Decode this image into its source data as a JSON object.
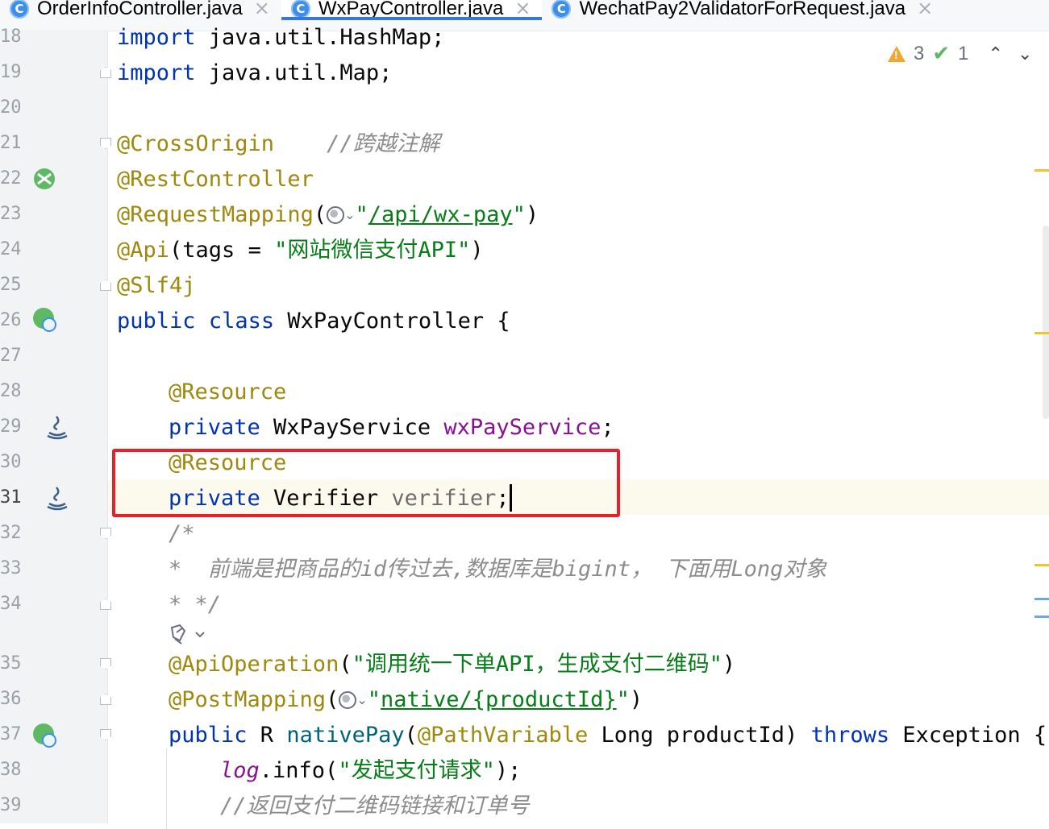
{
  "tabs": [
    {
      "icon": "C",
      "label": "OrderInfoController.java",
      "close": "×",
      "active": false
    },
    {
      "icon": "C",
      "label": "WxPayController.java",
      "close": "×",
      "active": true
    },
    {
      "icon": "C",
      "label": "WechatPay2ValidatorForRequest.java",
      "close": "×",
      "active": false
    }
  ],
  "inspections": {
    "warnings": "3",
    "ok": "1",
    "prev": "⌃",
    "next": "⌄"
  },
  "line_numbers": [
    "18",
    "19",
    "20",
    "21",
    "22",
    "23",
    "24",
    "25",
    "26",
    "27",
    "28",
    "29",
    "30",
    "31",
    "32",
    "33",
    "34",
    "35",
    "36",
    "37",
    "38",
    "39"
  ],
  "code": {
    "l18": {
      "kw": "import",
      "rest": " java.util.HashMap;"
    },
    "l19": {
      "kw": "import",
      "rest": " java.util.Map;"
    },
    "l21": {
      "ann": "@CrossOrigin",
      "comment": "//跨越注解"
    },
    "l22": {
      "ann": "@RestController"
    },
    "l23": {
      "ann": "@RequestMapping",
      "open": "(",
      "q1": "\"",
      "url": "/api/wx-pay",
      "q2": "\"",
      "close": ")"
    },
    "l24": {
      "ann": "@Api",
      "pre": "(tags = ",
      "str": "\"网站微信支付API\"",
      "close": ")"
    },
    "l25": {
      "ann": "@Slf4j"
    },
    "l26": {
      "kw1": "public",
      "kw2": "class",
      "name": " WxPayController {"
    },
    "l28": {
      "ann": "@Resource"
    },
    "l29": {
      "kw": "private",
      "type": " WxPayService ",
      "field": "wxPayService",
      "end": ";"
    },
    "l30": {
      "ann": "@Resource"
    },
    "l31": {
      "kw": "private",
      "type": " Verifier ",
      "field": "verifier",
      "end": ";"
    },
    "l32": {
      "comment": "/*"
    },
    "l33": {
      "comment": "*  前端是把商品的id传过去,数据库是bigint， 下面用Long对象"
    },
    "l34": {
      "comment": "* */"
    },
    "l35": {
      "ann": "@ApiOperation",
      "open": "(",
      "str": "\"调用统一下单API，生成支付二维码\"",
      "close": ")"
    },
    "l36": {
      "ann": "@PostMapping",
      "open": "(",
      "q1": "\"",
      "url": "native/{productId}",
      "q2": "\"",
      "close": ")"
    },
    "l37": {
      "kw": "public",
      "t1": " R ",
      "method": "nativePay",
      "p1": "(",
      "ann": "@PathVariable",
      "p2": " Long productId) ",
      "kw2": "throws",
      "p3": " Exception {"
    },
    "l38": {
      "static": "log",
      "mid": ".info(",
      "str": "\"发起支付请求\"",
      "end": ");"
    },
    "l39": {
      "comment": "//返回支付二维码链接和订单号"
    }
  },
  "colors": {
    "keyword": "#0033b3",
    "annotation": "#9e880d",
    "string": "#067d17",
    "comment": "#8c8c8c",
    "field": "#871094",
    "highlight_box": "#e8202a"
  },
  "icons": [
    "class-icon",
    "spring-bean-icon",
    "java-bean-icon",
    "web-endpoint-icon",
    "ai-assist-icon"
  ]
}
